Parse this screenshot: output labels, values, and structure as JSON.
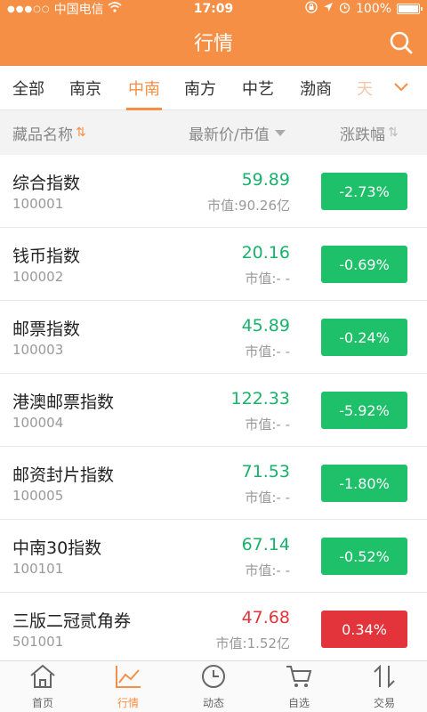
{
  "statusbar": {
    "carrier": "中国电信",
    "time": "17:09",
    "battery": "100%"
  },
  "titlebar": {
    "title": "行情"
  },
  "tabs": [
    {
      "label": "全部"
    },
    {
      "label": "南京"
    },
    {
      "label": "中南"
    },
    {
      "label": "南方"
    },
    {
      "label": "中艺"
    },
    {
      "label": "渤商"
    },
    {
      "label": "天"
    }
  ],
  "columns": {
    "name": "藏品名称",
    "price": "最新价/市值",
    "change": "涨跌幅"
  },
  "rows": [
    {
      "name": "综合指数",
      "code": "100001",
      "price": "59.89",
      "mcap": "市值:90.26亿",
      "change": "-2.73%",
      "trend": "down"
    },
    {
      "name": "钱币指数",
      "code": "100002",
      "price": "20.16",
      "mcap": "市值:- -",
      "change": "-0.69%",
      "trend": "down"
    },
    {
      "name": "邮票指数",
      "code": "100003",
      "price": "45.89",
      "mcap": "市值:- -",
      "change": "-0.24%",
      "trend": "down"
    },
    {
      "name": "港澳邮票指数",
      "code": "100004",
      "price": "122.33",
      "mcap": "市值:- -",
      "change": "-5.92%",
      "trend": "down"
    },
    {
      "name": "邮资封片指数",
      "code": "100005",
      "price": "71.53",
      "mcap": "市值:- -",
      "change": "-1.80%",
      "trend": "down"
    },
    {
      "name": "中南30指数",
      "code": "100101",
      "price": "67.14",
      "mcap": "市值:- -",
      "change": "-0.52%",
      "trend": "down"
    },
    {
      "name": "三版二冠贰角券",
      "code": "501001",
      "price": "47.68",
      "mcap": "市值:1.52亿",
      "change": "0.34%",
      "trend": "up"
    }
  ],
  "bottomnav": [
    {
      "label": "首页",
      "icon": "home-icon"
    },
    {
      "label": "行情",
      "icon": "chart-icon"
    },
    {
      "label": "动态",
      "icon": "clock-icon"
    },
    {
      "label": "自选",
      "icon": "cart-icon"
    },
    {
      "label": "交易",
      "icon": "exchange-icon"
    }
  ],
  "colors": {
    "brand": "#f58f46",
    "down": "#1ec069",
    "up": "#e3343c"
  }
}
